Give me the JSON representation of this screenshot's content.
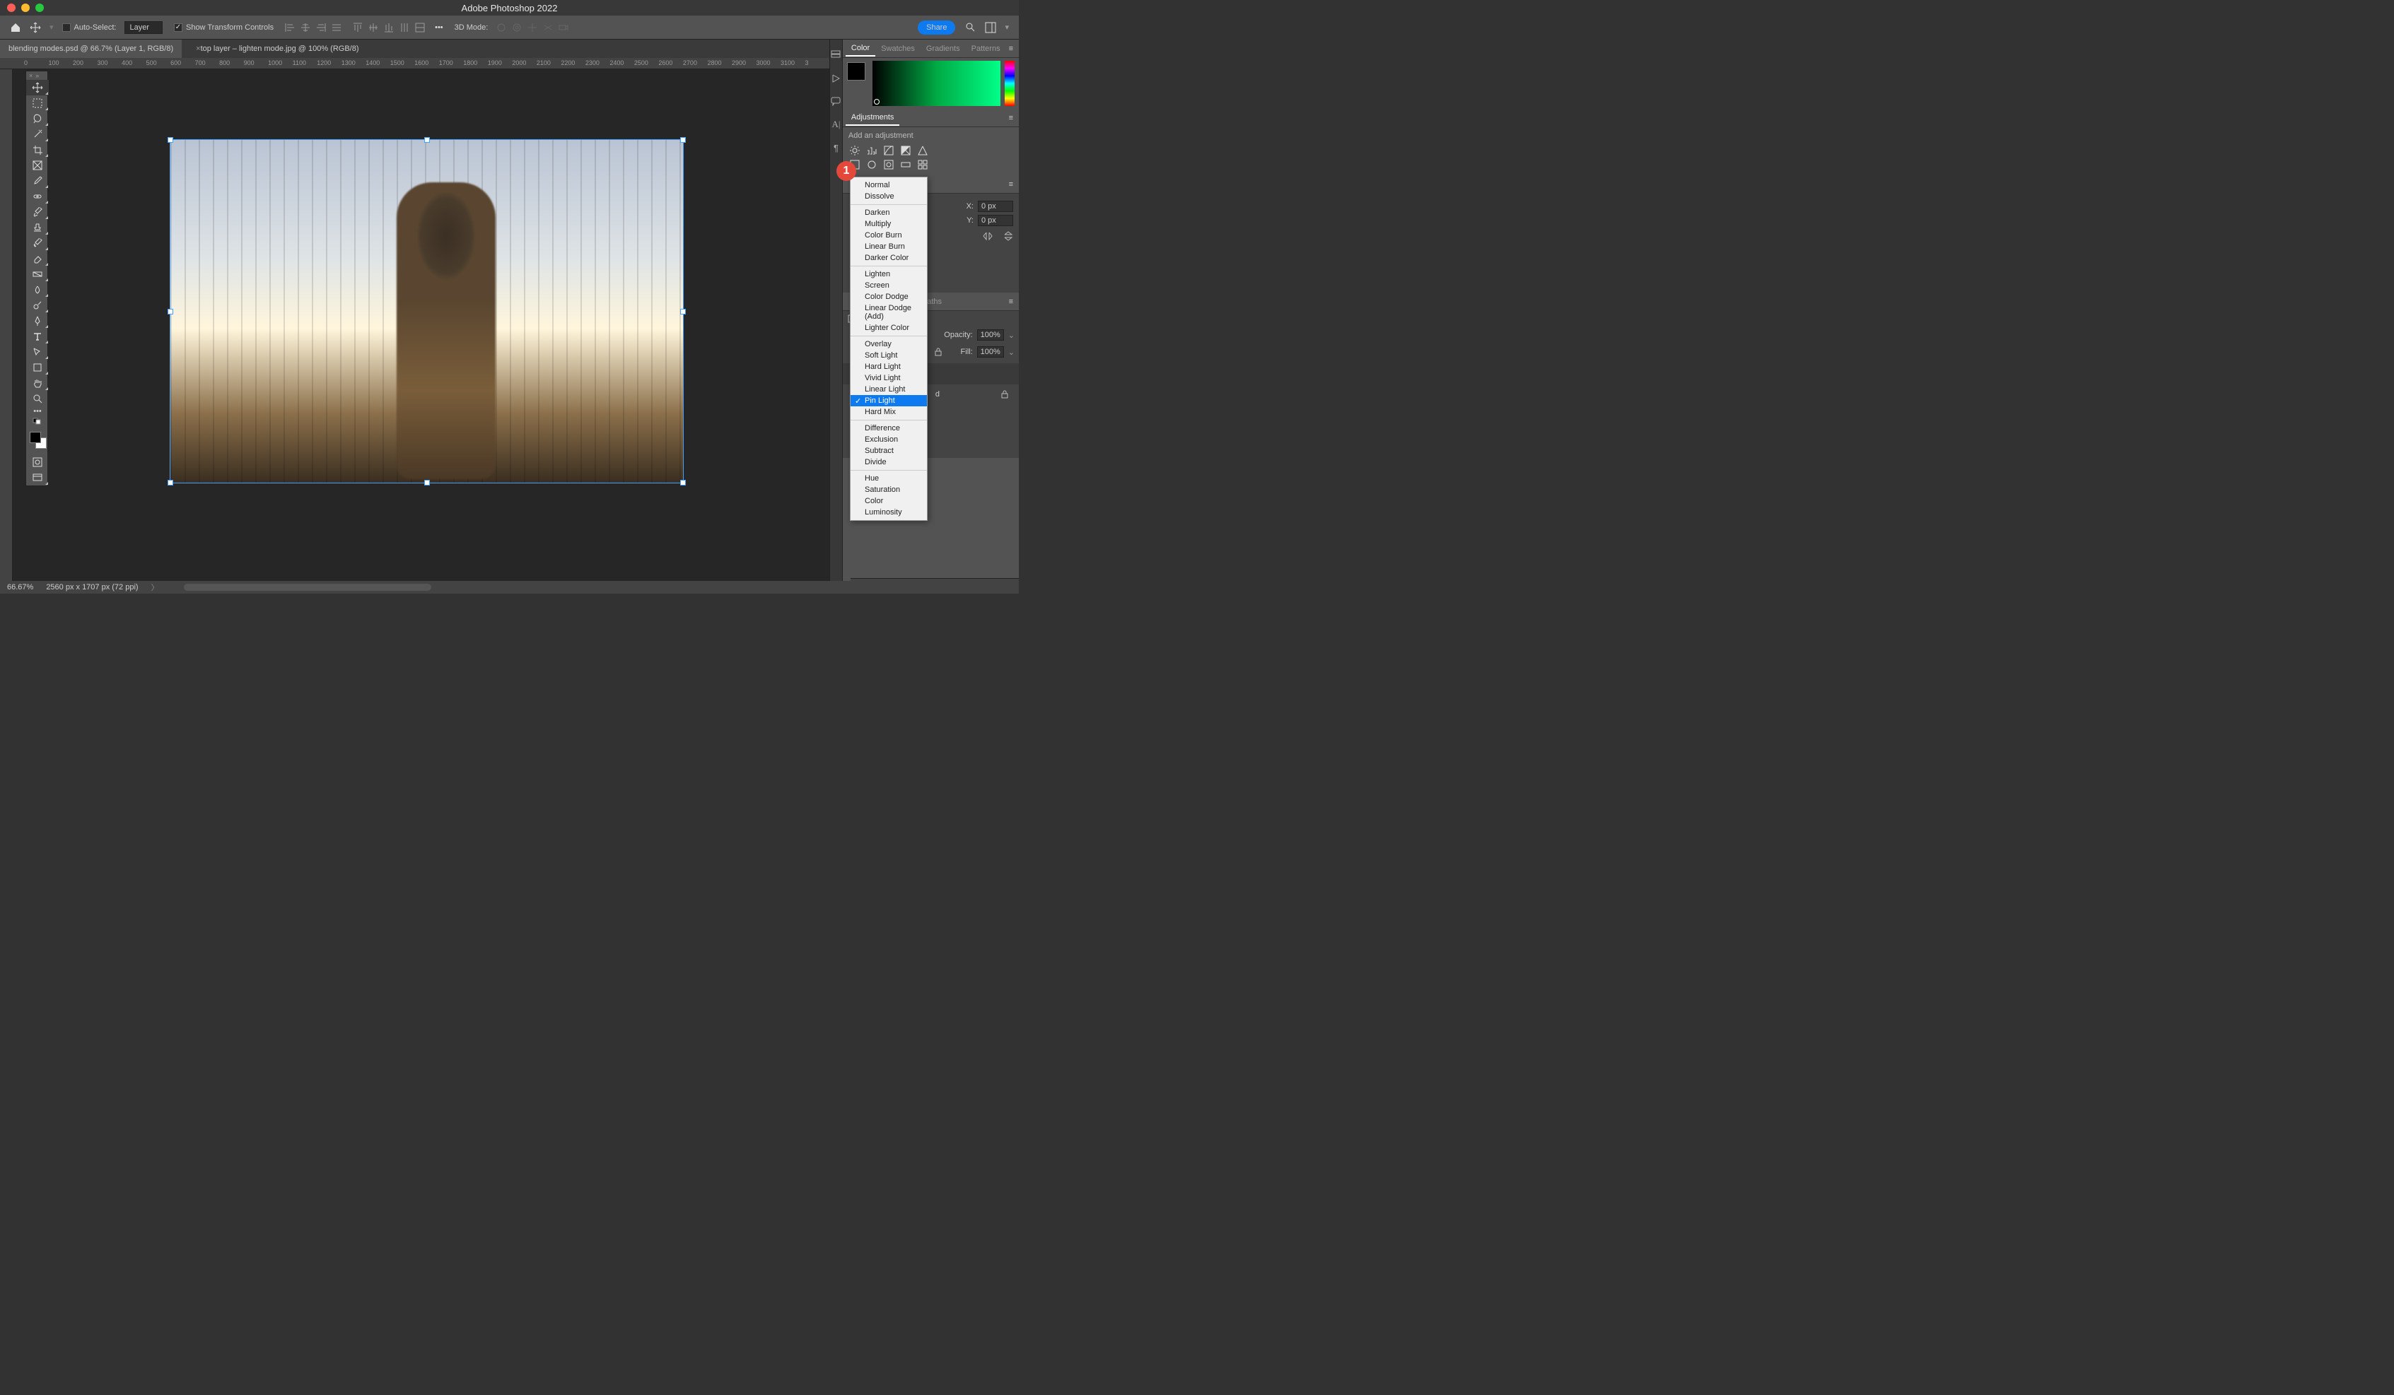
{
  "app": {
    "title": "Adobe Photoshop 2022"
  },
  "options": {
    "auto_select": "Auto-Select:",
    "auto_select_val": "Layer",
    "show_transform": "Show Transform Controls",
    "mode3d": "3D Mode:",
    "share": "Share"
  },
  "tabs": [
    {
      "label": "blending modes.psd @ 66.7% (Layer 1, RGB/8)",
      "active": true
    },
    {
      "label": "top layer – lighten mode.jpg @ 100% (RGB/8)",
      "active": false
    }
  ],
  "ruler_h": [
    "0",
    "100",
    "200",
    "300",
    "400",
    "500",
    "600",
    "700",
    "800",
    "900",
    "1000",
    "1100",
    "1200",
    "1300",
    "1400",
    "1500",
    "1600",
    "1700",
    "1800",
    "1900",
    "2000",
    "2100",
    "2200",
    "2300",
    "2400",
    "2500",
    "2600",
    "2700",
    "2800",
    "2900",
    "3000",
    "3100",
    "3"
  ],
  "panels": {
    "color_tabs": [
      "Color",
      "Swatches",
      "Gradients",
      "Patterns"
    ],
    "adjustments_tab": "Adjustments",
    "add_adj": "Add an adjustment"
  },
  "blend_modes": {
    "sections": [
      [
        "Normal",
        "Dissolve"
      ],
      [
        "Darken",
        "Multiply",
        "Color Burn",
        "Linear Burn",
        "Darker Color"
      ],
      [
        "Lighten",
        "Screen",
        "Color Dodge",
        "Linear Dodge (Add)",
        "Lighter Color"
      ],
      [
        "Overlay",
        "Soft Light",
        "Hard Light",
        "Vivid Light",
        "Linear Light",
        "Pin Light",
        "Hard Mix"
      ],
      [
        "Difference",
        "Exclusion",
        "Subtract",
        "Divide"
      ],
      [
        "Hue",
        "Saturation",
        "Color",
        "Luminosity"
      ]
    ],
    "selected": "Pin Light"
  },
  "marker": "1",
  "props": {
    "x_lbl": "X:",
    "x_val": "0 px",
    "y_lbl": "Y:",
    "y_val": "0 px"
  },
  "layers": {
    "tabs": [
      "Paths"
    ],
    "opacity_lbl": "Opacity:",
    "opacity_val": "100%",
    "fill_lbl": "Fill:",
    "fill_val": "100%"
  },
  "status": {
    "zoom": "66.67%",
    "dims": "2560 px x 1707 px (72 ppi)"
  }
}
